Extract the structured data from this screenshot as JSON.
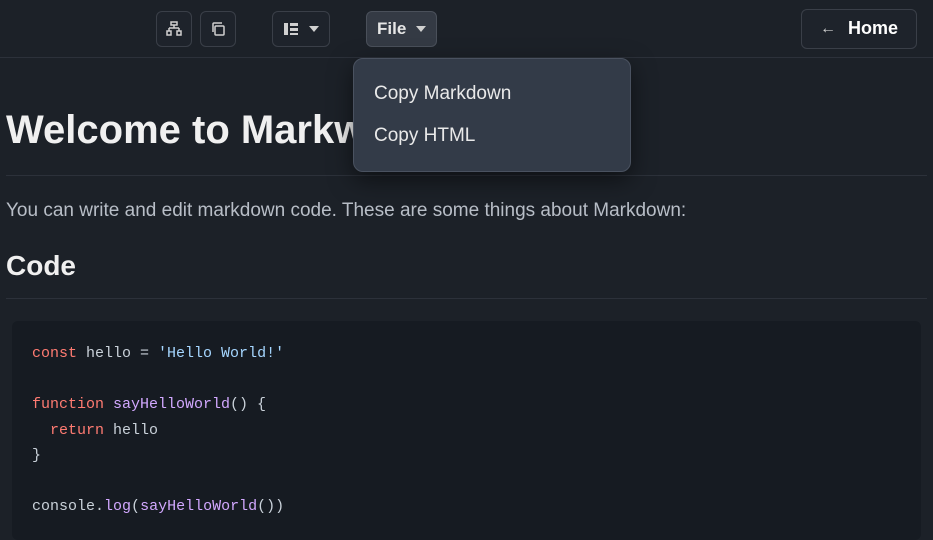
{
  "toolbar": {
    "file_label": "File",
    "home_label": "Home"
  },
  "menu": {
    "items": [
      "Copy Markdown",
      "Copy HTML"
    ]
  },
  "page": {
    "title": "Welcome to Markw",
    "intro": "You can write and edit markdown code. These are some things about Markdown:",
    "section_code": "Code"
  },
  "code": {
    "l1_kw": "const",
    "l1_var": " hello ",
    "l1_op": "=",
    "l1_str": " 'Hello World!'",
    "l3_kw": "function",
    "l3_fn": " sayHelloWorld",
    "l3_rest": "() {",
    "l4_kw": "  return",
    "l4_var": " hello",
    "l5": "}",
    "l7_obj": "console",
    "l7_dot": ".",
    "l7_fn": "log",
    "l7_open": "(",
    "l7_call": "sayHelloWorld",
    "l7_close": "())"
  }
}
